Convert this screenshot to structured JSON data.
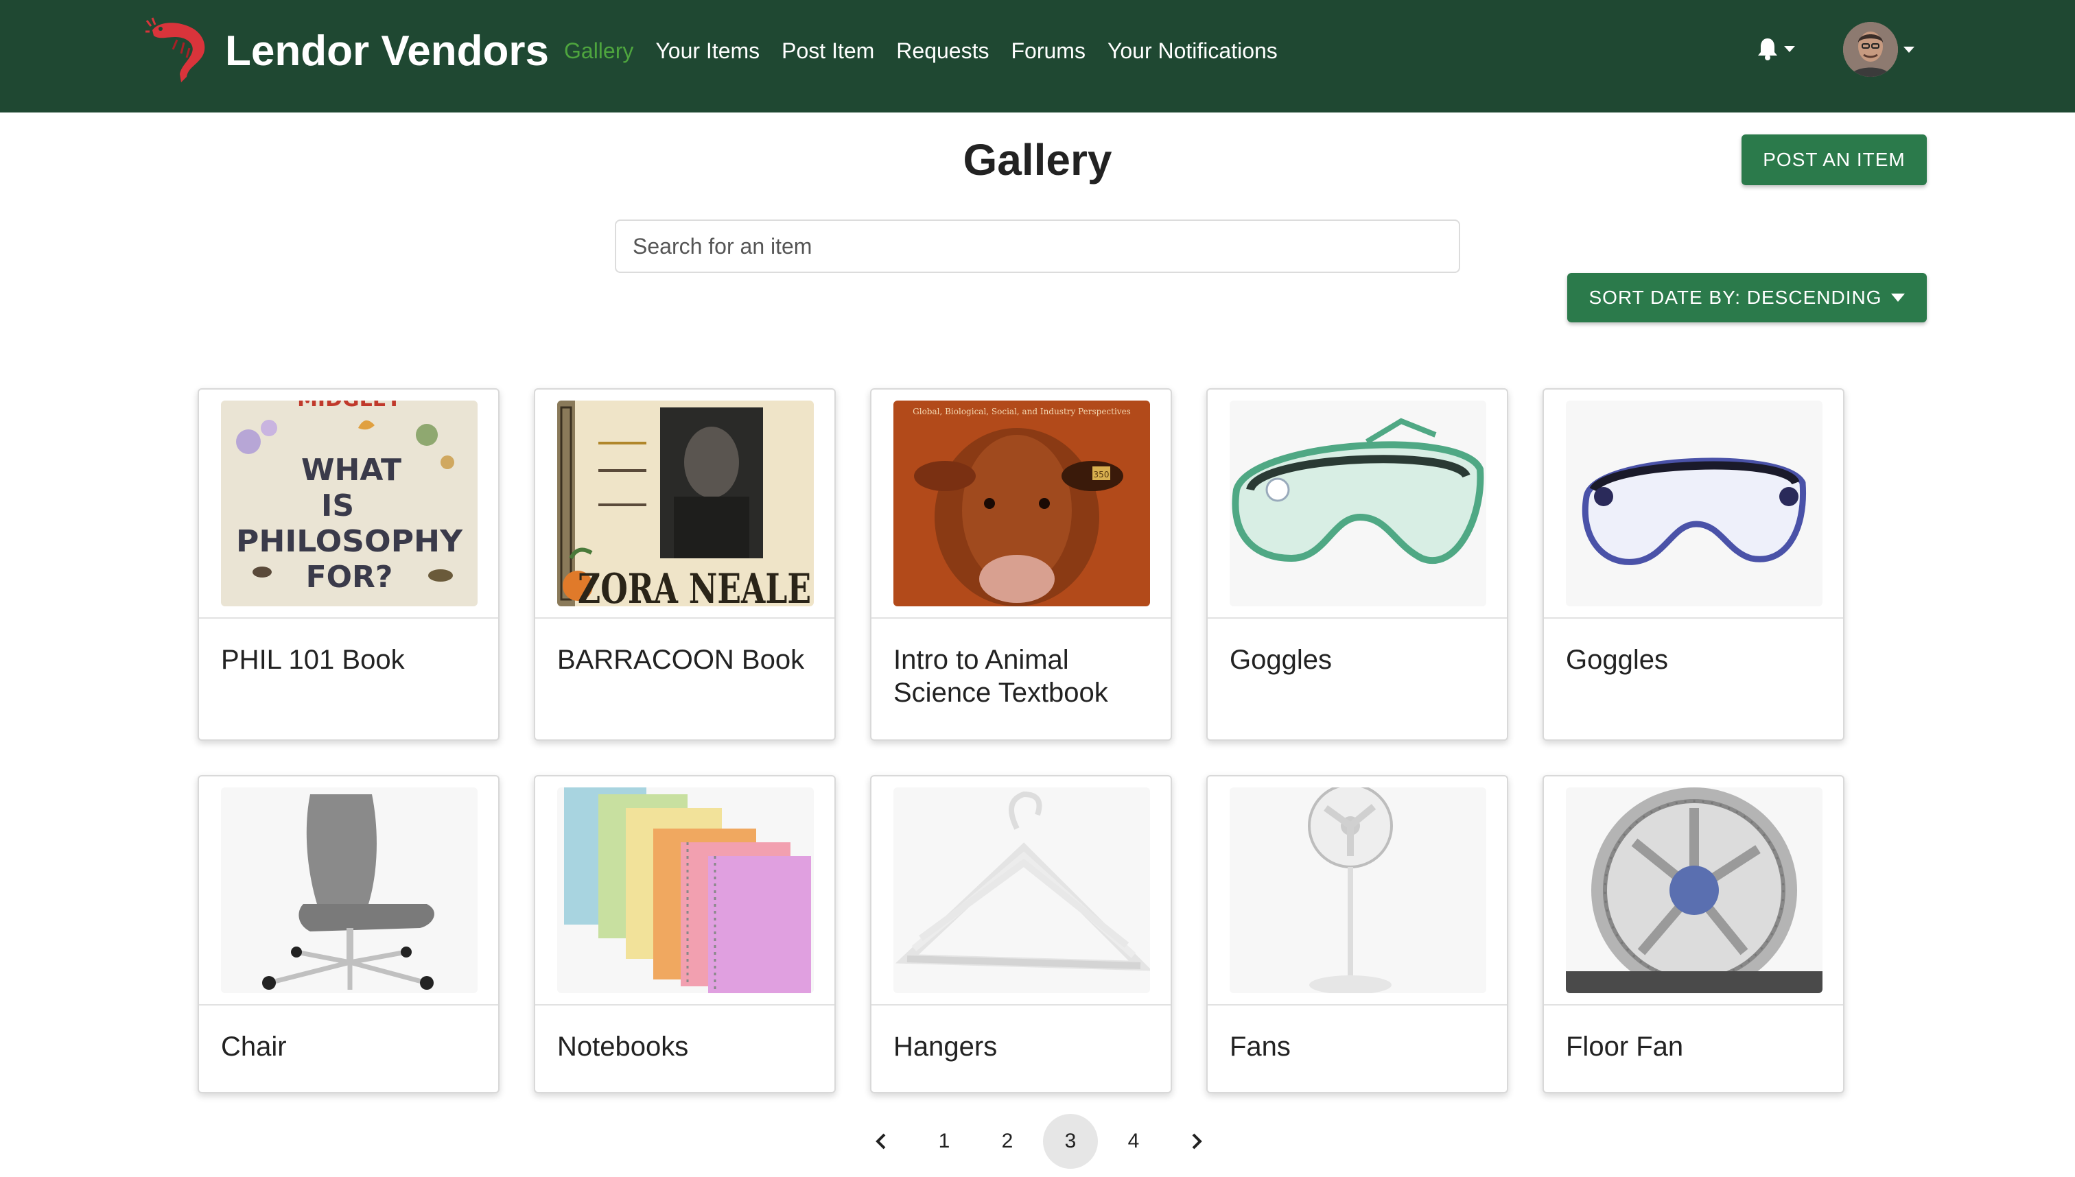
{
  "navbar": {
    "brand": "Lendor Vendors",
    "links": [
      {
        "label": "Gallery",
        "active": true
      },
      {
        "label": "Your Items",
        "active": false
      },
      {
        "label": "Post Item",
        "active": false
      },
      {
        "label": "Requests",
        "active": false
      },
      {
        "label": "Forums",
        "active": false
      },
      {
        "label": "Your Notifications",
        "active": false
      }
    ],
    "notification_icon": "bell-icon",
    "brand_icon": "shrimp-logo"
  },
  "header": {
    "title": "Gallery",
    "post_button": "POST AN ITEM",
    "search_placeholder": "Search for an item",
    "sort_button": "SORT DATE BY: DESCENDING"
  },
  "items": [
    {
      "title": "PHIL 101 Book",
      "image": "book-cover-what-is-philosophy-for"
    },
    {
      "title": "BARRACOON Book",
      "image": "book-cover-barracoon"
    },
    {
      "title": "Intro to Animal Science Textbook",
      "image": "textbook-cover-cow"
    },
    {
      "title": "Goggles",
      "image": "green-safety-goggles"
    },
    {
      "title": "Goggles",
      "image": "blue-safety-goggles"
    },
    {
      "title": "Chair",
      "image": "grey-office-chair"
    },
    {
      "title": "Notebooks",
      "image": "spiral-notebooks"
    },
    {
      "title": "Hangers",
      "image": "white-hangers"
    },
    {
      "title": "Fans",
      "image": "pedestal-fan"
    },
    {
      "title": "Floor Fan",
      "image": "floor-fan"
    }
  ],
  "book_texts": {
    "philosophy": [
      "MIDGLEY",
      "WHAT",
      "IS",
      "PHILOSOPHY",
      "FOR?"
    ],
    "barracoon": "ZORA NEALE",
    "animal_science": "Global, Biological, Social, and Industry Perspectives",
    "ear_tag": "350"
  },
  "pagination": {
    "prev_icon": "chevron-left-icon",
    "next_icon": "chevron-right-icon",
    "pages": [
      "1",
      "2",
      "3",
      "4"
    ],
    "current": "3"
  },
  "colors": {
    "navbar": "#1f4832",
    "active_link": "#4ea53e",
    "button": "#2b7a4b",
    "brand_logo": "#d9343b"
  }
}
